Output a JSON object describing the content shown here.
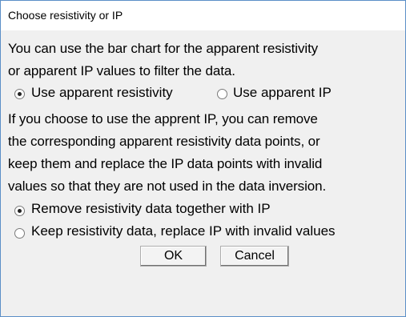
{
  "window": {
    "title": "Choose resistivity or IP"
  },
  "intro": {
    "line1": "You can use the bar chart for the apparent resistivity",
    "line2": "or apparent IP values to filter the data."
  },
  "source_options": {
    "resistivity_label": "Use apparent resistivity",
    "ip_label": "Use apparent IP",
    "selected": "resistivity"
  },
  "explanation": {
    "line1": "If you choose to use the apprent IP, you can remove",
    "line2": "the corresponding apparent resistivity data points, or",
    "line3": "keep them and replace the IP data points with invalid",
    "line4": "values so that they are not used in the data inversion."
  },
  "ip_handling_options": {
    "remove_label": "Remove resistivity data together with IP",
    "keep_label": "Keep resistivity data, replace IP with invalid values",
    "selected": "remove"
  },
  "buttons": {
    "ok_label": "OK",
    "cancel_label": "Cancel"
  }
}
